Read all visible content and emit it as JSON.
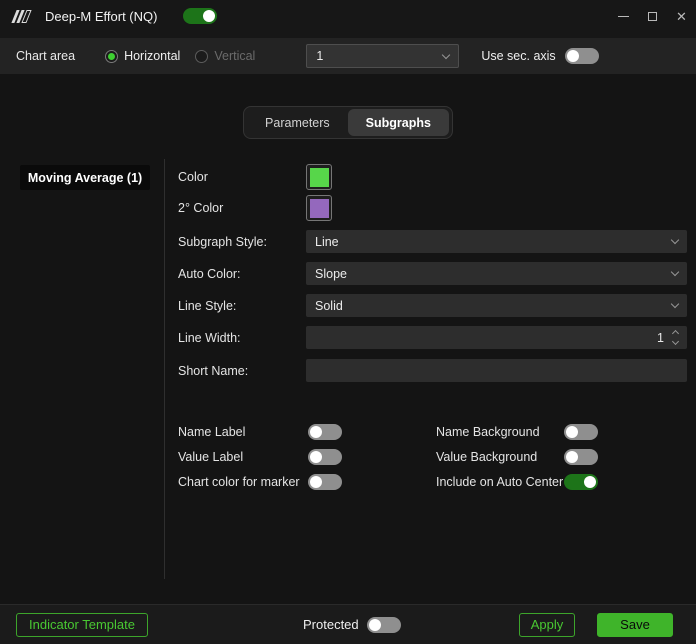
{
  "window": {
    "title": "Deep-M Effort (NQ)",
    "indicator_enabled": true,
    "controls": {
      "minimize_icon": "minimize",
      "maximize_icon": "maximize",
      "close_icon": "✕"
    }
  },
  "chart_area": {
    "label": "Chart area",
    "horizontal": {
      "label": "Horizontal",
      "selected": true
    },
    "vertical": {
      "label": "Vertical",
      "selected": false
    },
    "area_number_value": "1",
    "sec_axis_label": "Use sec. axis",
    "sec_axis_on": false
  },
  "tabs": [
    {
      "label": "Parameters",
      "active": false
    },
    {
      "label": "Subgraphs",
      "active": true
    }
  ],
  "sidebar": {
    "items": [
      {
        "label": "Moving Average (1)",
        "selected": true
      }
    ]
  },
  "subgraph": {
    "color_label": "Color",
    "color_value": "#57d64a",
    "color2_label": "2° Color",
    "color2_value": "#9468bd",
    "style_label": "Subgraph Style:",
    "style_value": "Line",
    "auto_color_label": "Auto Color:",
    "auto_color_value": "Slope",
    "line_style_label": "Line Style:",
    "line_style_value": "Solid",
    "line_width_label": "Line Width:",
    "line_width_value": "1",
    "short_name_label": "Short Name:",
    "short_name_value": ""
  },
  "toggles": {
    "name_label": {
      "label": "Name Label",
      "on": false
    },
    "value_label": {
      "label": "Value Label",
      "on": false
    },
    "chart_color_marker": {
      "label": "Chart color for marker",
      "on": false
    },
    "name_background": {
      "label": "Name Background",
      "on": false
    },
    "value_background": {
      "label": "Value Background",
      "on": false
    },
    "include_auto_center": {
      "label": "Include on Auto Center",
      "on": true
    }
  },
  "footer": {
    "indicator_template_label": "Indicator Template",
    "protected_label": "Protected",
    "protected_on": false,
    "apply_label": "Apply",
    "save_label": "Save"
  },
  "colors": {
    "accent_green": "#3fb42a",
    "toggle_on_green": "#1d7419",
    "swatch_green": "#57d64a",
    "swatch_purple": "#9468bd"
  }
}
